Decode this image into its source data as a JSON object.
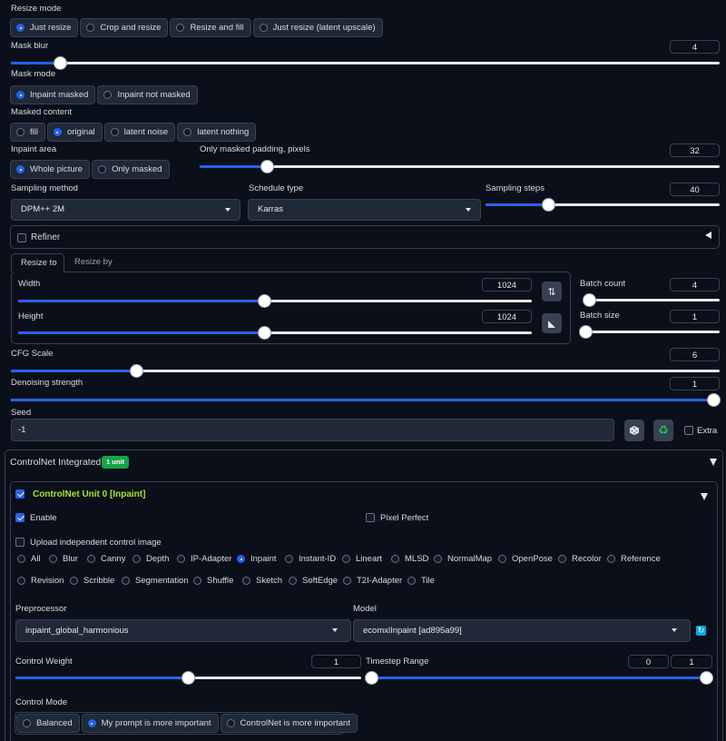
{
  "resize_mode": {
    "label": "Resize mode",
    "options": [
      "Just resize",
      "Crop and resize",
      "Resize and fill",
      "Just resize (latent upscale)"
    ],
    "selected": "Just resize"
  },
  "mask_blur": {
    "label": "Mask blur",
    "value": "4",
    "fraction": 0.07
  },
  "mask_mode": {
    "label": "Mask mode",
    "options": [
      "Inpaint masked",
      "Inpaint not masked"
    ],
    "selected": "Inpaint masked"
  },
  "masked_content": {
    "label": "Masked content",
    "options": [
      "fill",
      "original",
      "latent noise",
      "latent nothing"
    ],
    "selected": "original"
  },
  "inpaint_area": {
    "label": "Inpaint area",
    "options": [
      "Whole picture",
      "Only masked"
    ],
    "selected": "Whole picture"
  },
  "only_masked_padding": {
    "label": "Only masked padding, pixels",
    "value": "32",
    "fraction": 0.13
  },
  "sampling_method": {
    "label": "Sampling method",
    "value": "DPM++ 2M"
  },
  "schedule_type": {
    "label": "Schedule type",
    "value": "Karras"
  },
  "sampling_steps": {
    "label": "Sampling steps",
    "value": "40",
    "fraction": 0.27
  },
  "refiner": {
    "label": "Refiner",
    "checked": false
  },
  "size_tabs": {
    "tabs": [
      "Resize to",
      "Resize by"
    ],
    "active": "Resize to"
  },
  "width": {
    "label": "Width",
    "value": "1024",
    "fraction": 0.48
  },
  "height": {
    "label": "Height",
    "value": "1024",
    "fraction": 0.48
  },
  "batch_count": {
    "label": "Batch count",
    "value": "4",
    "fraction": 0.03
  },
  "batch_size": {
    "label": "Batch size",
    "value": "1",
    "fraction": 0.0
  },
  "cfg_scale": {
    "label": "CFG Scale",
    "value": "6",
    "fraction": 0.177
  },
  "denoising_strength": {
    "label": "Denoising strength",
    "value": "1",
    "fraction": 1.0
  },
  "seed": {
    "label": "Seed",
    "value": "-1",
    "extra_label": "Extra"
  },
  "controlnet": {
    "title": "ControlNet Integrated",
    "badge": "1 unit",
    "unit_title": "ControlNet Unit 0 [Inpaint]",
    "enable_label": "Enable",
    "pixel_perfect_label": "Pixel Perfect",
    "upload_label": "Upload independent control image",
    "control_types_row1": [
      "All",
      "Blur",
      "Canny",
      "Depth",
      "IP-Adapter",
      "Inpaint",
      "Instant-ID",
      "Lineart",
      "MLSD",
      "NormalMap",
      "OpenPose",
      "Recolor",
      "Reference"
    ],
    "control_types_row2": [
      "Revision",
      "Scribble",
      "Segmentation",
      "Shuffle",
      "Sketch",
      "SoftEdge",
      "T2I-Adapter",
      "Tile"
    ],
    "selected_type": "Inpaint",
    "preprocessor_label": "Preprocessor",
    "preprocessor": "inpaint_global_harmonious",
    "model_label": "Model",
    "model": "ecomxlInpaint [ad895a99]",
    "control_weight_label": "Control Weight",
    "control_weight": "1",
    "control_weight_fraction": 0.5,
    "timestep_label": "Timestep Range",
    "timestep_start": "0",
    "timestep_end": "1",
    "control_mode_label": "Control Mode",
    "control_modes": [
      "Balanced",
      "My prompt is more important",
      "ControlNet is more important"
    ],
    "control_mode_selected": "My prompt is more important"
  }
}
